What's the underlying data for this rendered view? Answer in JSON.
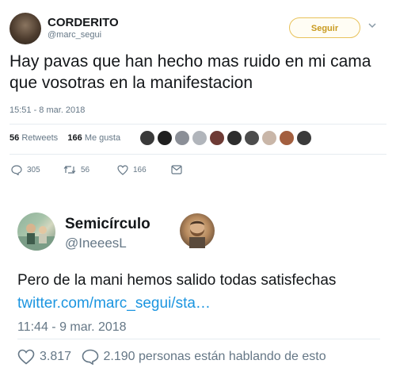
{
  "tweet1": {
    "name": "CORDERITO",
    "handle": "@marc_segui",
    "follow_label": "Seguir",
    "text": "Hay pavas que han hecho mas ruido en mi cama que vosotras en la manifestacion",
    "time": "15:51 - 8 mar. 2018",
    "retweets_count": "56",
    "retweets_label": "Retweets",
    "likes_count": "166",
    "likes_label": "Me gusta",
    "actions": {
      "replies": "305",
      "retweets": "56",
      "likes": "166"
    },
    "colors": {
      "follow_border": "#e8c25a",
      "follow_text": "#c99a1e"
    }
  },
  "tweet2": {
    "name": "Semicírculo",
    "handle": "@IneeesL",
    "text": "Pero de la mani hemos salido todas satisfechas",
    "link": "twitter.com/marc_segui/sta…",
    "time": "11:44 - 9 mar. 2018",
    "likes": "3.817",
    "conversation": "2.190 personas están hablando de esto",
    "colors": {
      "link": "#1b95e0"
    }
  },
  "icons": [
    "chevron-down-icon",
    "reply-icon",
    "retweet-icon",
    "heart-icon",
    "message-icon",
    "comment-icon"
  ]
}
